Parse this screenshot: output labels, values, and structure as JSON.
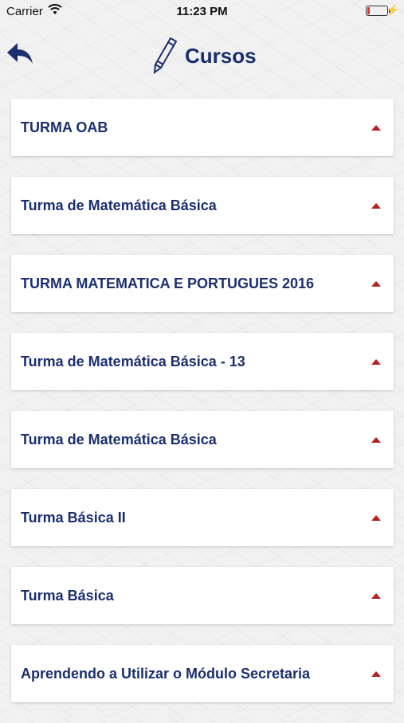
{
  "status_bar": {
    "carrier": "Carrier",
    "time": "11:23 PM",
    "battery_level": 0.15,
    "battery_color": "#e0312e"
  },
  "header": {
    "title": "Cursos",
    "back_icon": "back-arrow-icon",
    "title_icon": "pencil-icon",
    "title_color": "#1b2f6e"
  },
  "courses": [
    {
      "label": "TURMA OAB"
    },
    {
      "label": "Turma de Matemática Básica"
    },
    {
      "label": "TURMA MATEMATICA E PORTUGUES 2016"
    },
    {
      "label": "Turma de Matemática Básica - 13"
    },
    {
      "label": "Turma de Matemática Básica"
    },
    {
      "label": "Turma Básica II"
    },
    {
      "label": "Turma Básica"
    },
    {
      "label": "Aprendendo a Utilizar o Módulo Secretaria"
    }
  ],
  "accent_color": "#b32020"
}
